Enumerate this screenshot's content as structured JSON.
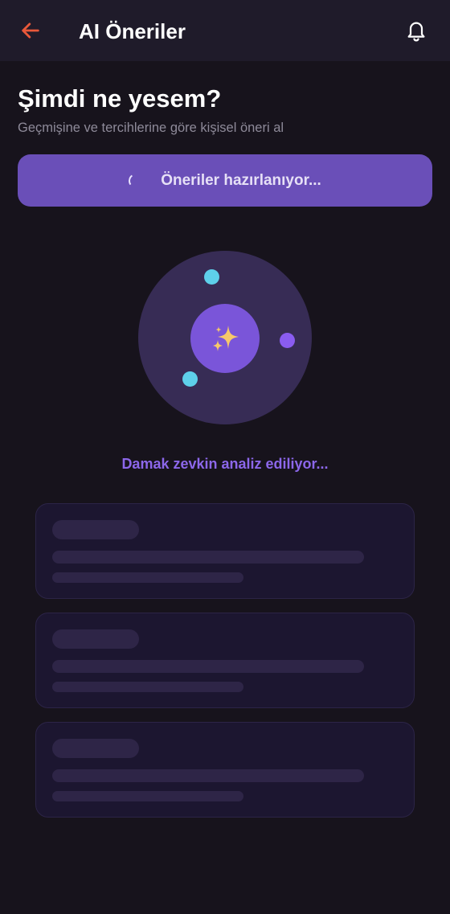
{
  "header": {
    "title": "AI Öneriler",
    "back_icon": "arrow-left-icon",
    "bell_icon": "bell-icon"
  },
  "intro": {
    "title": "Şimdi ne yesem?",
    "subtitle": "Geçmişine ve tercihlerine göre kişisel öneri al"
  },
  "cta": {
    "label": "Öneriler hazırlanıyor...",
    "loading": true
  },
  "orbit": {
    "center_icon": "sparkles-icon",
    "center_glyph": "✨"
  },
  "status": {
    "text": "Damak zevkin analiz ediliyor..."
  },
  "skeleton_cards": 3,
  "colors": {
    "background": "#17131c",
    "header": "#1f1b2a",
    "accent": "#6a4fb8",
    "accent_text": "#8c67ea",
    "back_arrow": "#e8583a",
    "cyan_dot": "#5ed0ea",
    "violet_dot": "#8a5cf0"
  }
}
